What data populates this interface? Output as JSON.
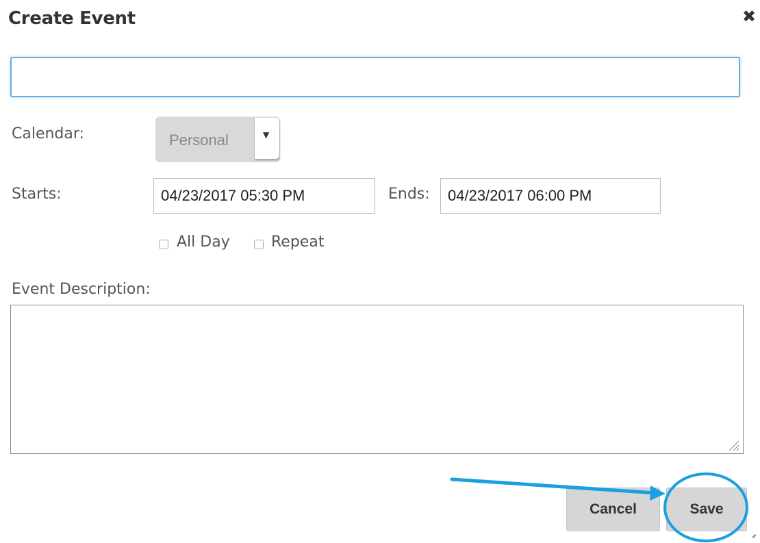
{
  "dialog": {
    "title": "Create Event",
    "close_glyph": "✖",
    "title_input": {
      "value": "",
      "placeholder": ""
    }
  },
  "form": {
    "calendar_label": "Calendar:",
    "calendar_value": "Personal",
    "calendar_arrow_glyph": "▼",
    "starts_label": "Starts:",
    "starts_value": "04/23/2017 05:30 PM",
    "ends_label": "Ends:",
    "ends_value": "04/23/2017 06:00 PM",
    "all_day_label": "All Day",
    "repeat_label": "Repeat",
    "description_label": "Event Description:",
    "description_value": ""
  },
  "buttons": {
    "cancel_label": "Cancel",
    "save_label": "Save"
  },
  "annotation": {
    "color": "#1a9fe0",
    "arrow_icon": "arrow-right-icon",
    "highlight_icon": "circle-highlight-icon"
  },
  "colors": {
    "focus_border": "#66aee0",
    "button_bg": "#d6d6d6",
    "select_bg": "#d9d9d9"
  }
}
